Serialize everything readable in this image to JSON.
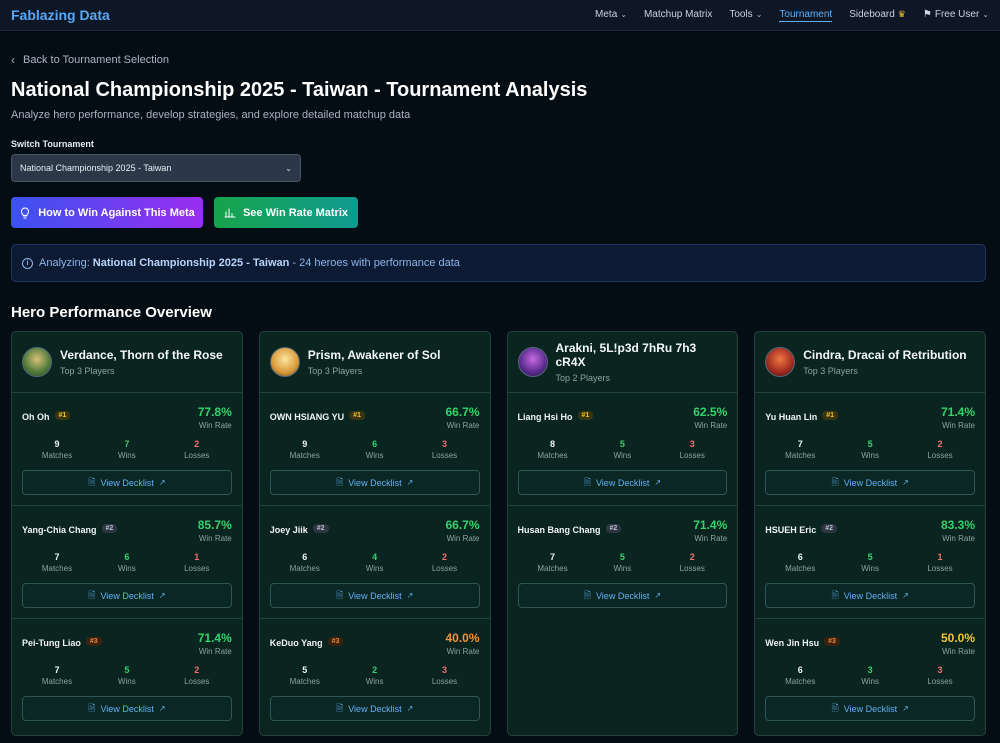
{
  "nav": {
    "brand": "Fablazing Data",
    "items": [
      {
        "label": "Meta",
        "chevron": true
      },
      {
        "label": "Matchup Matrix",
        "chevron": false
      },
      {
        "label": "Tools",
        "chevron": true
      },
      {
        "label": "Tournament",
        "chevron": false,
        "active": true
      },
      {
        "label": "Sideboard",
        "chevron": false
      }
    ],
    "user_label": "Free User"
  },
  "back_label": "Back to Tournament Selection",
  "page_title": "National Championship 2025 - Taiwan - Tournament Analysis",
  "page_subtitle": "Analyze hero performance, develop strategies, and explore detailed matchup data",
  "switch": {
    "label": "Switch Tournament",
    "selected": "National Championship 2025 - Taiwan"
  },
  "buttons": {
    "meta": "How to Win Against This Meta",
    "matrix": "See Win Rate Matrix"
  },
  "banner": {
    "prefix": "Analyzing:",
    "tournament": "National Championship 2025 - Taiwan",
    "suffix": "- 24 heroes with performance data"
  },
  "section_title": "Hero Performance Overview",
  "labels": {
    "win_rate": "Win Rate",
    "matches": "Matches",
    "wins": "Wins",
    "losses": "Losses",
    "view_decklist": "View Decklist"
  },
  "colors": {
    "win_green": "#34d36a",
    "loss_red": "#f07070",
    "link_blue": "#60b0f8"
  },
  "heroes": [
    {
      "name": "Verdance, Thorn of the Rose",
      "subtitle": "Top 3 Players",
      "players": [
        {
          "name": "Oh Oh",
          "rank": "#1",
          "win_rate": "77.8%",
          "matches": "9",
          "wins": "7",
          "losses": "2"
        },
        {
          "name": "Yang-Chia Chang",
          "rank": "#2",
          "win_rate": "85.7%",
          "matches": "7",
          "wins": "6",
          "losses": "1"
        },
        {
          "name": "Pei-Tung Liao",
          "rank": "#3",
          "win_rate": "71.4%",
          "matches": "7",
          "wins": "5",
          "losses": "2"
        }
      ]
    },
    {
      "name": "Prism, Awakener of Sol",
      "subtitle": "Top 3 Players",
      "players": [
        {
          "name": "OWN HSIANG YU",
          "rank": "#1",
          "win_rate": "66.7%",
          "matches": "9",
          "wins": "6",
          "losses": "3"
        },
        {
          "name": "Joey Jiik",
          "rank": "#2",
          "win_rate": "66.7%",
          "matches": "6",
          "wins": "4",
          "losses": "2"
        },
        {
          "name": "KeDuo Yang",
          "rank": "#3",
          "win_rate": "40.0%",
          "matches": "5",
          "wins": "2",
          "losses": "3"
        }
      ]
    },
    {
      "name": "Arakni, 5L!p3d 7hRu 7h3 cR4X",
      "subtitle": "Top 2 Players",
      "players": [
        {
          "name": "Liang Hsi Ho",
          "rank": "#1",
          "win_rate": "62.5%",
          "matches": "8",
          "wins": "5",
          "losses": "3"
        },
        {
          "name": "Husan Bang Chang",
          "rank": "#2",
          "win_rate": "71.4%",
          "matches": "7",
          "wins": "5",
          "losses": "2"
        }
      ]
    },
    {
      "name": "Cindra, Dracai of Retribution",
      "subtitle": "Top 3 Players",
      "players": [
        {
          "name": "Yu Huan Lin",
          "rank": "#1",
          "win_rate": "71.4%",
          "matches": "7",
          "wins": "5",
          "losses": "2"
        },
        {
          "name": "HSUEH Eric",
          "rank": "#2",
          "win_rate": "83.3%",
          "matches": "6",
          "wins": "5",
          "losses": "1"
        },
        {
          "name": "Wen Jin Hsu",
          "rank": "#3",
          "win_rate": "50.0%",
          "matches": "6",
          "wins": "3",
          "losses": "3"
        }
      ]
    }
  ]
}
